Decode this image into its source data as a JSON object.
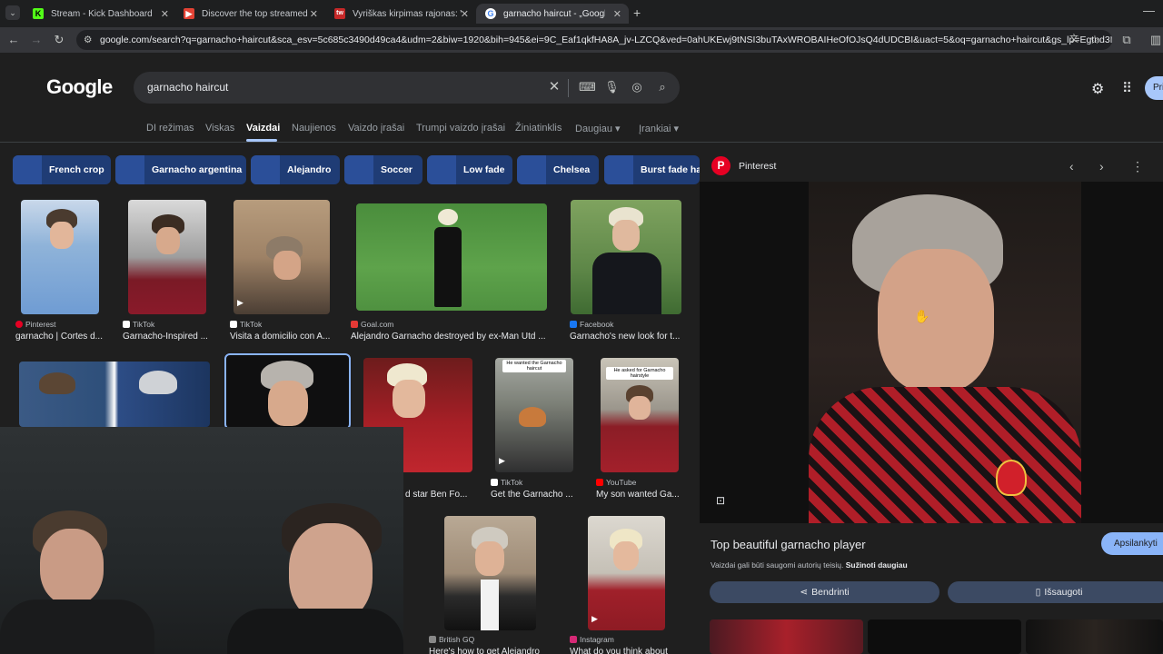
{
  "browser": {
    "tabs": [
      {
        "title": "Stream - Kick Dashboard",
        "icon": "kick-icon",
        "color": "#53fc18",
        "glyph": "K"
      },
      {
        "title": "Discover the top streamed music",
        "icon": "music-icon",
        "color": "#e34234",
        "glyph": "▶"
      },
      {
        "title": "Vyriškas kirpimas rajonas: Vilnius",
        "icon": "salon-icon",
        "color": "#c62828",
        "glyph": "tw"
      },
      {
        "title": "garnacho haircut - „Google“ paieška",
        "icon": "google-icon",
        "color": "#4285f4",
        "glyph": "G"
      }
    ],
    "url": "google.com/search?q=garnacho+haircut&sca_esv=5c685c3490d49ca4&udm=2&biw=1920&bih=945&ei=9C_Eaf1qkfHA8A_jv-LZCQ&ved=0ahUKEwj9tNSI3buTAxWROBAIHeOfOJsQ4dUDCBI&uact=5&oq=garnacho+haircut&gs_lp=Egtnd3Mtd..."
  },
  "google": {
    "logo": "Google",
    "query": "garnacho haircut",
    "nav": [
      "DI režimas",
      "Viskas",
      "Vaizdai",
      "Naujienos",
      "Vaizdo įrašai",
      "Trumpi vaizdo įrašai",
      "Žiniatinklis",
      "Daugiau ▾",
      "Įrankiai ▾"
    ],
    "profile": "Pri"
  },
  "chips": [
    "French crop",
    "Garnacho argentina",
    "Alejandro",
    "Soccer",
    "Low fade",
    "Chelsea",
    "Burst fade hai"
  ],
  "results": [
    {
      "source": "Pinterest",
      "caption": "garnacho | Cortes d...",
      "color": "#e60023"
    },
    {
      "source": "TikTok",
      "caption": "Garnacho-Inspired ...",
      "color": "#ffffff"
    },
    {
      "source": "TikTok",
      "caption": "Visita a domicilio con A...",
      "color": "#ffffff"
    },
    {
      "source": "Goal.com",
      "caption": "Alejandro Garnacho destroyed by ex-Man Utd ...",
      "color": "#e53935"
    },
    {
      "source": "Facebook",
      "caption": "Garnacho's new look for t...",
      "color": "#1877f2"
    },
    {
      "source": "",
      "caption": "d star Ben Fo...",
      "color": "#e53935"
    },
    {
      "source": "TikTok",
      "caption": "Get the Garnacho ...",
      "color": "#ffffff"
    },
    {
      "source": "YouTube",
      "caption": "My son wanted Ga...",
      "color": "#ff0000"
    },
    {
      "source": "British GQ",
      "caption": "Here's how to get Alejandro",
      "color": "#888888"
    },
    {
      "source": "Instagram",
      "caption": "What do you think about",
      "color": "#d62976"
    }
  ],
  "thumb_texts": {
    "barber": "He wanted the Garnacho haircut",
    "kid": "He asked for Garnacho hairstyle"
  },
  "panel": {
    "source": "Pinterest",
    "title": "Top beautiful garnacho player",
    "note": "Vaizdai gali būti saugomi autorių teisių.",
    "note_link": "Sužinoti daugiau",
    "visit": "Apsilankyti",
    "share": "Bendrinti",
    "save": "Išsaugoti"
  }
}
